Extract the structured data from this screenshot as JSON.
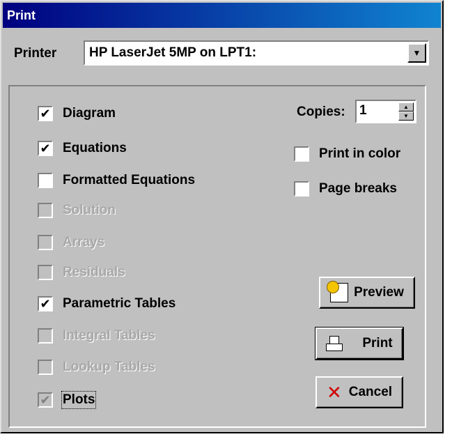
{
  "window": {
    "title": "Print"
  },
  "printer": {
    "label": "Printer",
    "selected": "HP LaserJet 5MP on LPT1:",
    "dropdown_icon": "chevron-down-icon"
  },
  "options": [
    {
      "id": "diagram",
      "label": "Diagram",
      "checked": true,
      "enabled": true
    },
    {
      "id": "equations",
      "label": "Equations",
      "checked": true,
      "enabled": true
    },
    {
      "id": "formatted-equations",
      "label": "Formatted Equations",
      "checked": false,
      "enabled": true
    },
    {
      "id": "solution",
      "label": "Solution",
      "checked": false,
      "enabled": false
    },
    {
      "id": "arrays",
      "label": "Arrays",
      "checked": false,
      "enabled": false
    },
    {
      "id": "residuals",
      "label": "Residuals",
      "checked": false,
      "enabled": false
    },
    {
      "id": "parametric-tables",
      "label": "Parametric Tables",
      "checked": true,
      "enabled": true
    },
    {
      "id": "integral-tables",
      "label": "Integral Tables",
      "checked": false,
      "enabled": false
    },
    {
      "id": "lookup-tables",
      "label": "Lookup Tables",
      "checked": false,
      "enabled": false
    },
    {
      "id": "plots",
      "label": "Plots",
      "checked": true,
      "enabled": false
    }
  ],
  "copies": {
    "label": "Copies:",
    "value": "1"
  },
  "print_in_color": {
    "label": "Print in color",
    "checked": false
  },
  "page_breaks": {
    "label": "Page breaks",
    "checked": false
  },
  "buttons": {
    "preview": "Preview",
    "print": "Print",
    "cancel": "Cancel"
  }
}
